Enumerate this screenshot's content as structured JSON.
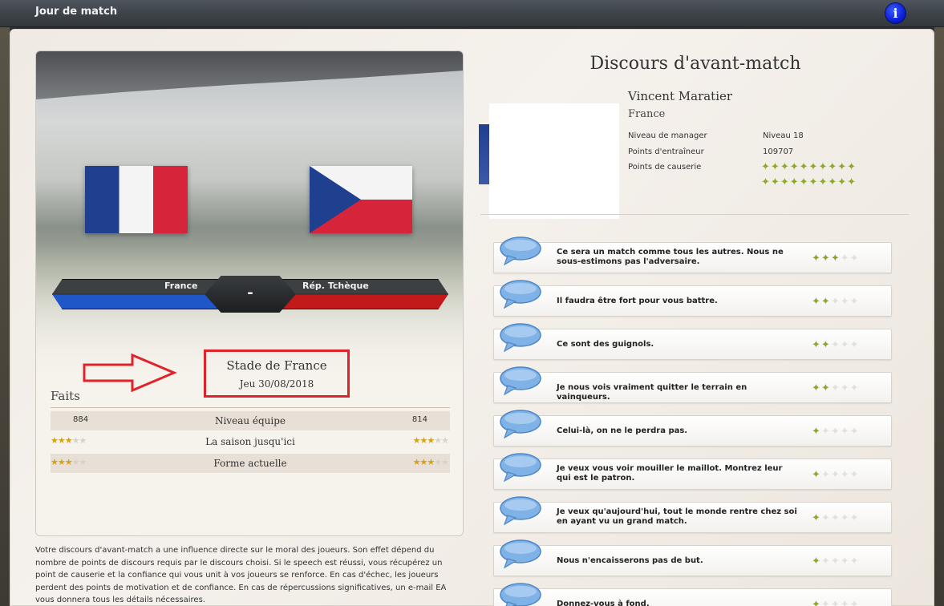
{
  "header": {
    "title": "Jour de match",
    "info_icon": "i"
  },
  "match": {
    "home_team": "France",
    "away_team": "Rép. Tchèque",
    "score": "-",
    "venue": "Stade de France",
    "date": "Jeu 30/08/2018"
  },
  "facts": {
    "title": "Faits",
    "rows": [
      {
        "label": "Niveau équipe",
        "home": "884",
        "away": "814"
      },
      {
        "label": "La saison jusqu'ici",
        "home_stars": 3,
        "away_stars": 3
      },
      {
        "label": "Forme actuelle",
        "home_stars": 3,
        "away_stars": 3
      }
    ]
  },
  "description": "Votre discours d'avant-match a une influence directe sur le moral des joueurs. Son effet dépend du nombre de points de discours requis par le discours choisi. Si le speech est réussi, vous récupérez un point de causerie et la confiance qui vous unit à vos joueurs se renforce. En cas d'échec, les joueurs perdent des points de motivation et de confiance. En cas de répercussions significatives, un e-mail EA vous donnera tous les détails nécessaires.",
  "speech": {
    "title": "Discours d'avant-match",
    "manager": {
      "name": "Vincent Maratier",
      "country": "France",
      "level_label": "Niveau de manager",
      "level_value": "Niveau 18",
      "points_label": "Points d'entraîneur",
      "points_value": "109707",
      "talk_label": "Points de causerie",
      "talk_points": 20
    },
    "options": [
      {
        "text": "Ce sera un match comme tous les autres. Nous ne sous-estimons pas l'adversaire.",
        "cost": 3
      },
      {
        "text": "Il faudra être fort pour vous battre.",
        "cost": 2
      },
      {
        "text": "Ce sont des guignols.",
        "cost": 2
      },
      {
        "text": "Je nous vois vraiment quitter le terrain en vainqueurs.",
        "cost": 2
      },
      {
        "text": "Celui-là, on ne le perdra pas.",
        "cost": 1
      },
      {
        "text": "Je veux vous voir mouiller le maillot. Montrez leur qui est le patron.",
        "cost": 1
      },
      {
        "text": "Je veux qu'aujourd'hui, tout le monde rentre chez soi en ayant vu un grand match.",
        "cost": 1
      },
      {
        "text": "Nous n'encaisserons pas de but.",
        "cost": 1
      },
      {
        "text": "Donnez-vous à fond.",
        "cost": 1
      }
    ]
  },
  "colors": {
    "accent_red": "#e0232b",
    "whistle_green": "#8fa82a",
    "info_blue": "#0b1fd6"
  }
}
